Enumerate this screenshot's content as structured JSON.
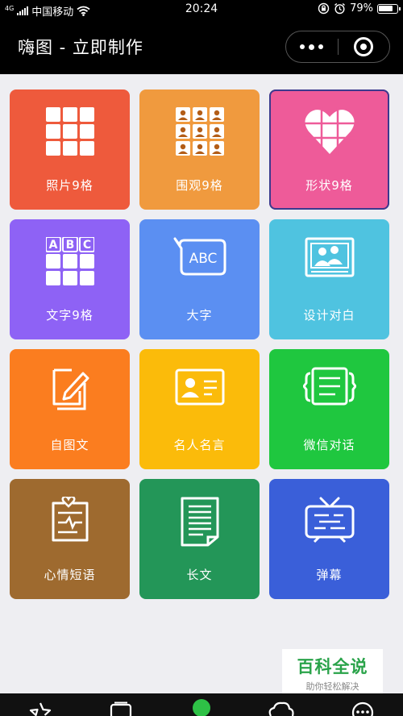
{
  "status_bar": {
    "sim_index": "4G",
    "carrier": "中国移动",
    "time": "20:24",
    "battery": "79%"
  },
  "nav": {
    "title": "嗨图 - 立即制作"
  },
  "tiles": [
    {
      "label": "照片9格",
      "color": "#ee5a3c",
      "icon": "grid-icon"
    },
    {
      "label": "围观9格",
      "color": "#f09a3e",
      "icon": "people-grid-icon"
    },
    {
      "label": "形状9格",
      "color": "#ee5b99",
      "icon": "heart-grid-icon"
    },
    {
      "label": "文字9格",
      "color": "#8e62f5",
      "icon": "abc-grid-icon"
    },
    {
      "label": "大字",
      "color": "#5b8ff2",
      "icon": "speech-bubble-abc-icon"
    },
    {
      "label": "设计对白",
      "color": "#4fc3e0",
      "icon": "dialogue-frame-icon"
    },
    {
      "label": "自图文",
      "color": "#fb7d1f",
      "icon": "edit-document-icon"
    },
    {
      "label": "名人名言",
      "color": "#fbbb0a",
      "icon": "id-card-icon"
    },
    {
      "label": "微信对话",
      "color": "#1fc73f",
      "icon": "chat-message-icon"
    },
    {
      "label": "心情短语",
      "color": "#9e6a2f",
      "icon": "mood-note-icon"
    },
    {
      "label": "长文",
      "color": "#239658",
      "icon": "long-document-icon"
    },
    {
      "label": "弹幕",
      "color": "#3a5fd9",
      "icon": "tv-bullet-icon"
    }
  ],
  "watermark": {
    "line1": "百科全说",
    "line2": "助你轻松解决"
  },
  "tab_icons": [
    "star-icon",
    "image-icon",
    "home-icon",
    "cloud-icon",
    "message-icon"
  ]
}
